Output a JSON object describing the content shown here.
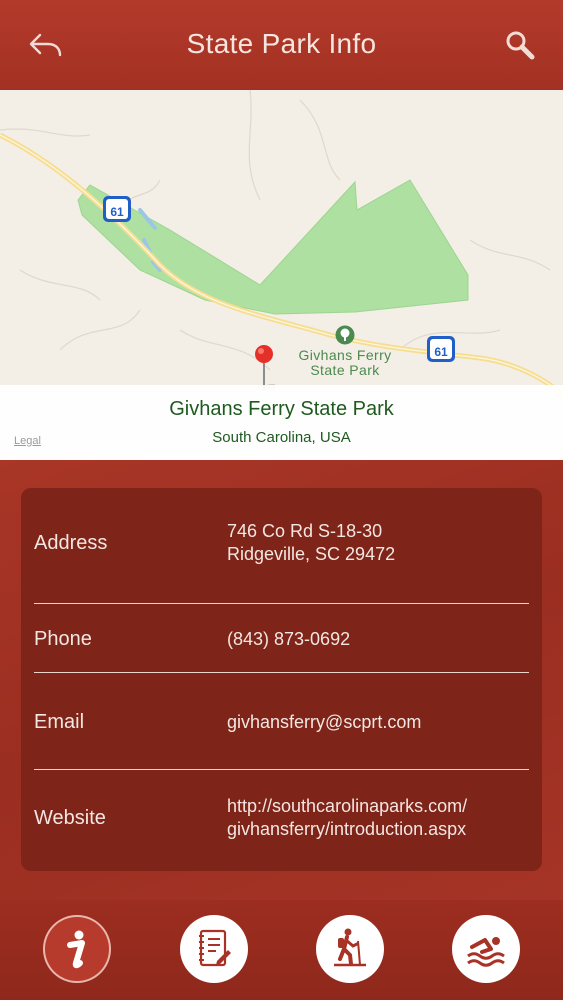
{
  "header": {
    "title": "State Park Info",
    "back_icon": "undo-arrow-icon",
    "search_icon": "search-icon"
  },
  "map": {
    "park_label_line1": "Givhans Ferry",
    "park_label_line2": "State Park",
    "route_shield": "61",
    "caption_title": "Givhans Ferry State Park",
    "caption_subtitle": "South Carolina, USA",
    "legal": "Legal"
  },
  "info": {
    "rows": [
      {
        "label": "Address",
        "value": "746 Co Rd S-18-30\nRidgeville, SC 29472"
      },
      {
        "label": "Phone",
        "value": "(843) 873-0692"
      },
      {
        "label": "Email",
        "value": "givhansferry@scprt.com"
      },
      {
        "label": "Website",
        "value": "http://southcarolinaparks.com/\ngivhansferry/introduction.aspx"
      }
    ]
  },
  "tabs": [
    {
      "name": "info",
      "icon": "info-icon",
      "active": true
    },
    {
      "name": "notes",
      "icon": "notebook-icon",
      "active": false
    },
    {
      "name": "hiking",
      "icon": "hiker-icon",
      "active": false
    },
    {
      "name": "swimming",
      "icon": "swimmer-icon",
      "active": false
    }
  ],
  "colors": {
    "header": "#b33a2b",
    "card": "#7e2418",
    "park_green": "#aee0a1",
    "caption_text": "#1e5a1f"
  }
}
